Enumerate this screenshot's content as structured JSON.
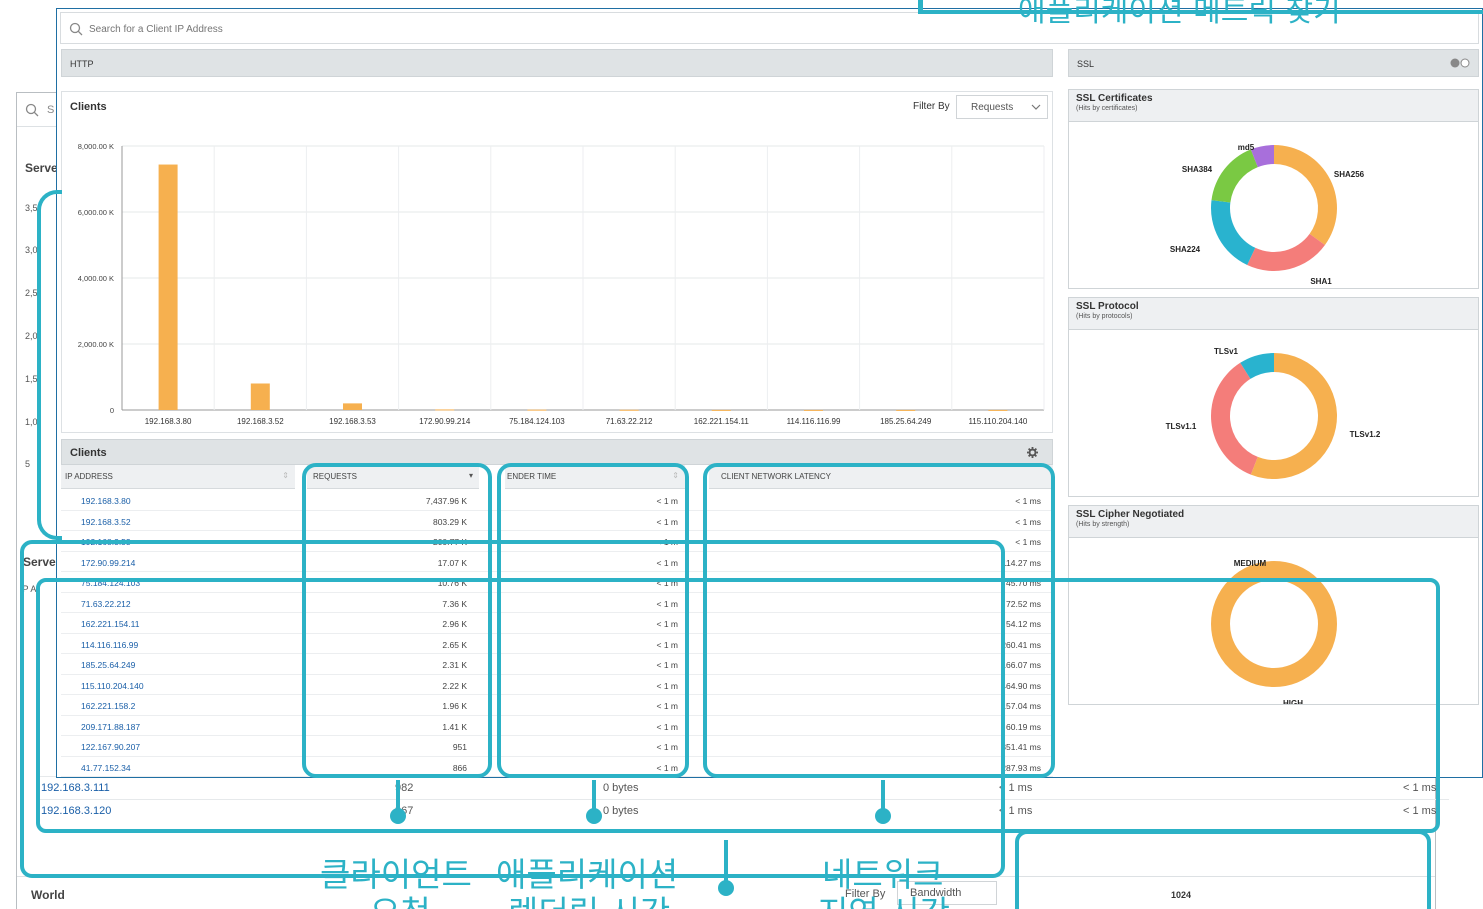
{
  "background_window": {
    "search_placeholder": "S",
    "servers_label": "Serve",
    "servers_label_2": "Serve",
    "ip_header": "IP A",
    "axis_labels": [
      "3,5",
      "3,0",
      "2,5",
      "2,0",
      "1,5",
      "1,0",
      "5"
    ],
    "rows": [
      {
        "ip": "192.168.3.111",
        "requests": "982",
        "bandwidth": "0 bytes",
        "time": "< 1 ms",
        "latency": "< 1 ms"
      },
      {
        "ip": "192.168.3.120",
        "requests": "967",
        "bandwidth": "0 bytes",
        "time": "< 1 ms",
        "latency": "< 1 ms"
      }
    ],
    "world_label": "World",
    "filter_label": "Filter By",
    "filter_value": "Bandwidth",
    "donut_label": "1024"
  },
  "search": {
    "placeholder": "Search for a Client IP Address"
  },
  "http_bar": {
    "label": "HTTP"
  },
  "chart_panel": {
    "title": "Clients",
    "filter_label": "Filter By",
    "filter_value": "Requests"
  },
  "chart_data": {
    "type": "bar",
    "title": "Clients",
    "categories": [
      "192.168.3.80",
      "192.168.3.52",
      "192.168.3.53",
      "172.90.99.214",
      "75.184.124.103",
      "71.63.22.212",
      "162.221.154.11",
      "114.116.116.99",
      "185.25.64.249",
      "115.110.204.140"
    ],
    "values": [
      7437.96,
      803.29,
      200.77,
      17.07,
      10.76,
      7.36,
      2.96,
      2.65,
      2.31,
      2.22
    ],
    "ylim": [
      0,
      8000
    ],
    "yticks": [
      "0",
      "2,000.00 K",
      "4,000.00 K",
      "6,000.00 K",
      "8,000.00 K"
    ],
    "grid": true,
    "bar_color": "#f6b04f"
  },
  "table": {
    "title": "Clients",
    "columns": {
      "ip": "IP ADDRESS",
      "requests": "REQUESTS",
      "render": "ENDER TIME",
      "latency": "CLIENT NETWORK LATENCY"
    },
    "rows": [
      {
        "ip": "192.168.3.80",
        "requests": "7,437.96 K",
        "render": "< 1 m",
        "latency": "< 1 ms"
      },
      {
        "ip": "192.168.3.52",
        "requests": "803.29 K",
        "render": "< 1 m",
        "latency": "< 1 ms"
      },
      {
        "ip": "192.168.3.53",
        "requests": "200.77 K",
        "render": "< 1 m",
        "latency": "< 1 ms"
      },
      {
        "ip": "172.90.99.214",
        "requests": "17.07 K",
        "render": "< 1 m",
        "latency": "114.27 ms"
      },
      {
        "ip": "75.184.124.103",
        "requests": "10.76 K",
        "render": "< 1 m",
        "latency": "45.70 ms"
      },
      {
        "ip": "71.63.22.212",
        "requests": "7.36 K",
        "render": "< 1 m",
        "latency": "72.52 ms"
      },
      {
        "ip": "162.221.154.11",
        "requests": "2.96 K",
        "render": "< 1 m",
        "latency": "54.12 ms"
      },
      {
        "ip": "114.116.116.99",
        "requests": "2.65 K",
        "render": "< 1 m",
        "latency": "260.41 ms"
      },
      {
        "ip": "185.25.64.249",
        "requests": "2.31 K",
        "render": "< 1 m",
        "latency": "166.07 ms"
      },
      {
        "ip": "115.110.204.140",
        "requests": "2.22 K",
        "render": "< 1 m",
        "latency": "464.90 ms"
      },
      {
        "ip": "162.221.158.2",
        "requests": "1.96 K",
        "render": "< 1 m",
        "latency": "157.04 ms"
      },
      {
        "ip": "209.171.88.187",
        "requests": "1.41 K",
        "render": "< 1 m",
        "latency": "60.19 ms"
      },
      {
        "ip": "122.167.90.207",
        "requests": "951",
        "render": "< 1 m",
        "latency": "351.41 ms"
      },
      {
        "ip": "41.77.152.34",
        "requests": "866",
        "render": "< 1 m",
        "latency": "287.93 ms"
      }
    ]
  },
  "ssl": {
    "bar_label": "SSL",
    "cards": [
      {
        "title": "SSL Certificates",
        "subtitle": "(Hits by certificates)",
        "slices": [
          {
            "label": "SHA256",
            "value": 35,
            "color": "#f6b04f"
          },
          {
            "label": "SHA1",
            "value": 22,
            "color": "#f47d7a"
          },
          {
            "label": "SHA224",
            "value": 20,
            "color": "#29b3cf"
          },
          {
            "label": "SHA384",
            "value": 17,
            "color": "#7ac943"
          },
          {
            "label": "md5",
            "value": 6,
            "color": "#a86fdb"
          }
        ]
      },
      {
        "title": "SSL Protocol",
        "subtitle": "(Hits by protocols)",
        "slices": [
          {
            "label": "TLSv1.2",
            "value": 56,
            "color": "#f6b04f"
          },
          {
            "label": "TLSv1.1",
            "value": 35,
            "color": "#f47d7a"
          },
          {
            "label": "TLSv1",
            "value": 9,
            "color": "#29b3cf"
          }
        ]
      },
      {
        "title": "SSL Cipher Negotiated",
        "subtitle": "(Hits by strength)",
        "slices": [
          {
            "label": "HIGH",
            "value": 100,
            "color": "#f6b04f"
          },
          {
            "label": "MEDIUM",
            "value": 0,
            "color": "#f47d7a"
          }
        ]
      }
    ]
  },
  "annotations": {
    "top_right": "애플리케이션 메트릭 찾기",
    "client_requests": [
      "클라이언트",
      "요청"
    ],
    "app_render": [
      "애플리케이션",
      "렌더링 시간"
    ],
    "network_latency": [
      "네트워크",
      "지연 시간"
    ],
    "color": "#2cb2c6"
  }
}
